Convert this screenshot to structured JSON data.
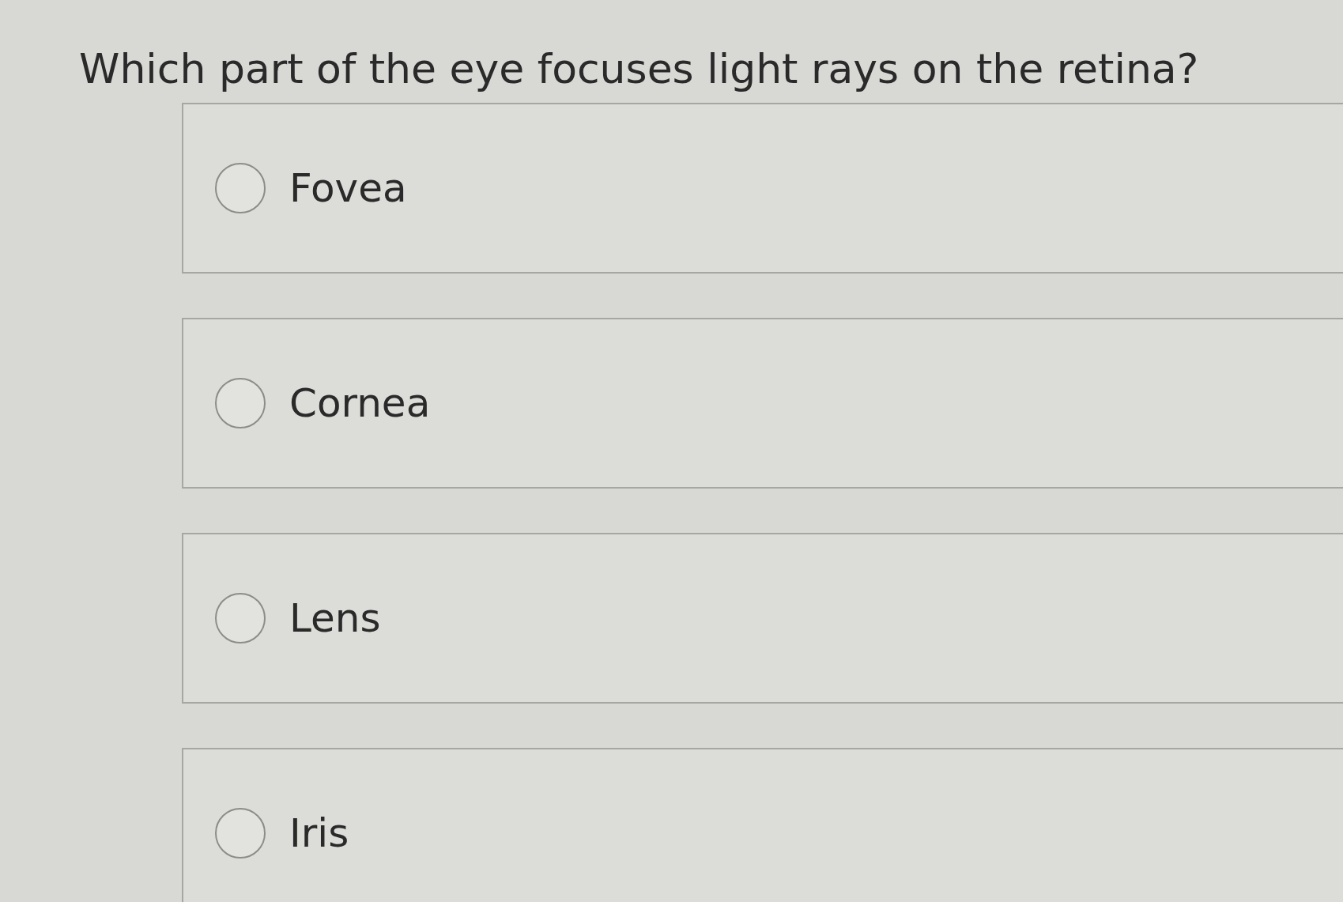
{
  "question": "Which part of the eye focuses light rays on the retina?",
  "options": [
    {
      "label": "Fovea",
      "selected": false
    },
    {
      "label": "Cornea",
      "selected": false
    },
    {
      "label": "Lens",
      "selected": false
    },
    {
      "label": "Iris",
      "selected": false
    }
  ]
}
